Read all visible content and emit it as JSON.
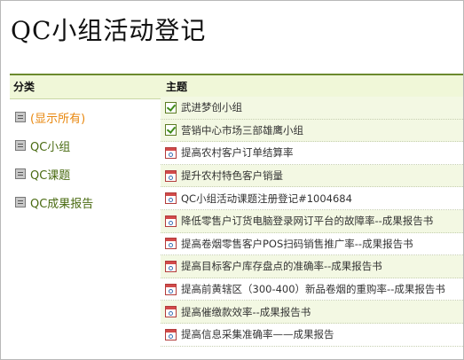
{
  "page": {
    "title": "QC小组活动登记"
  },
  "table": {
    "col_category": "分类",
    "col_topic": "主题"
  },
  "sidebar": {
    "items": [
      {
        "label": "(显示所有)",
        "active": true,
        "icon": "category-icon"
      },
      {
        "label": "QC小组",
        "active": false,
        "icon": "category-icon"
      },
      {
        "label": "QC课题",
        "active": false,
        "icon": "category-icon"
      },
      {
        "label": "QC成果报告",
        "active": false,
        "icon": "category-icon"
      }
    ]
  },
  "rows": [
    {
      "label": "武进梦创小组",
      "icon": "check-icon"
    },
    {
      "label": "营销中心市场三部雄鹰小组",
      "icon": "check-icon"
    },
    {
      "label": "提高农村客户订单结算率",
      "icon": "calendar-icon"
    },
    {
      "label": "提升农村特色客户销量",
      "icon": "calendar-icon"
    },
    {
      "label": "QC小组活动课题注册登记#1004684",
      "icon": "calendar-icon"
    },
    {
      "label": "降低零售户订货电脑登录网订平台的故障率--成果报告书",
      "icon": "calendar-icon"
    },
    {
      "label": "提高卷烟零售客户POS扫码销售推广率--成果报告书",
      "icon": "calendar-icon"
    },
    {
      "label": "提高目标客户库存盘点的准确率--成果报告书",
      "icon": "calendar-icon"
    },
    {
      "label": "提高前黄辖区（300-400）新品卷烟的重购率--成果报告书",
      "icon": "calendar-icon"
    },
    {
      "label": "提高催缴款效率--成果报告书",
      "icon": "calendar-icon"
    },
    {
      "label": "提高信息采集准确率——成果报告",
      "icon": "calendar-icon"
    }
  ]
}
